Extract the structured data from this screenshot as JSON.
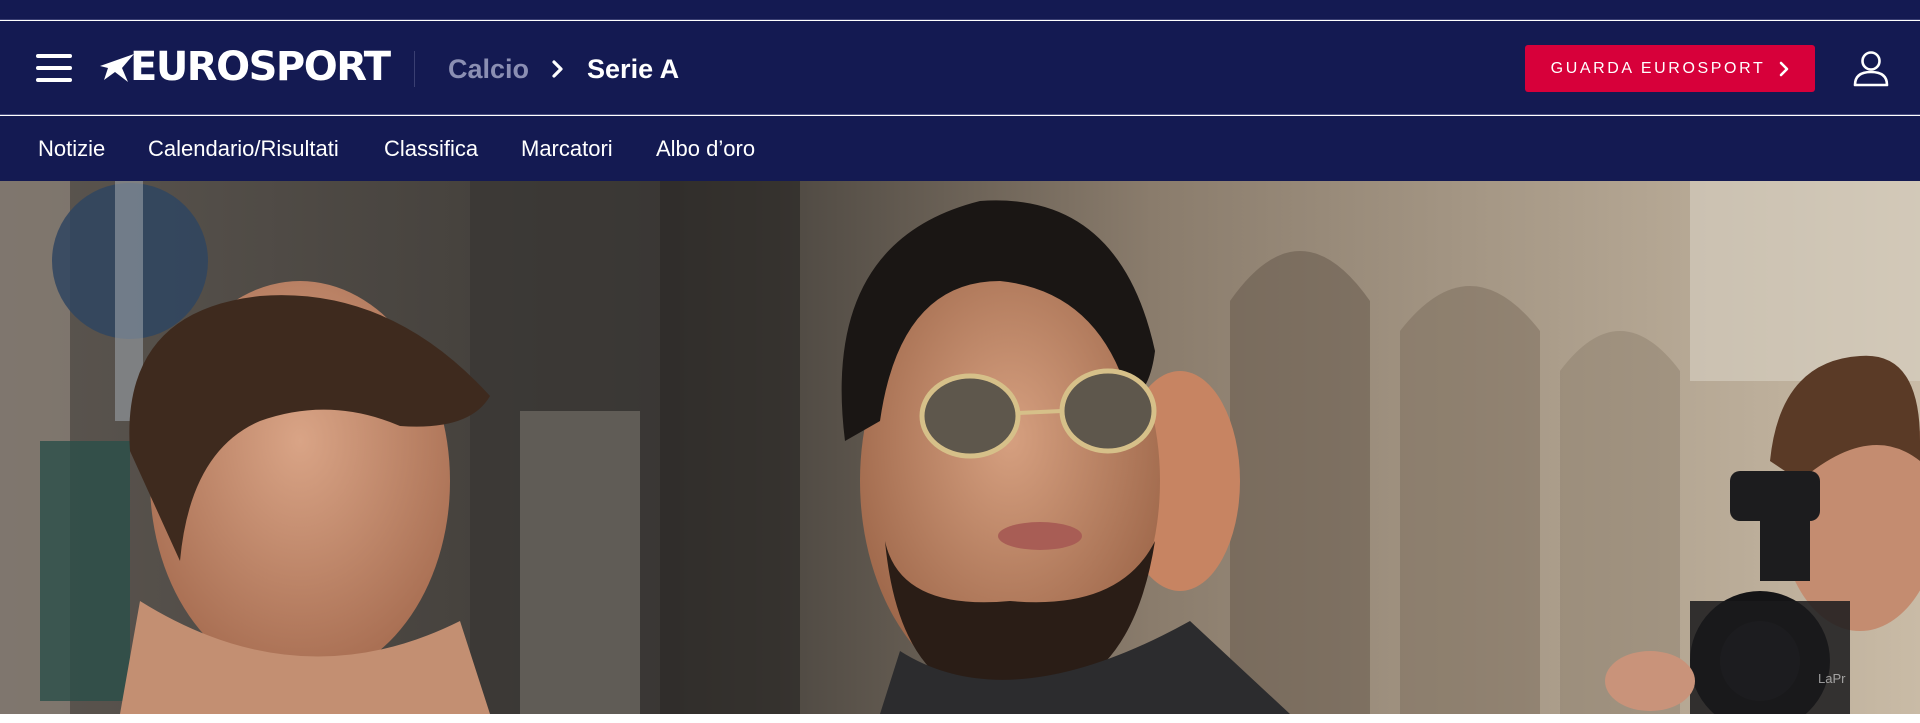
{
  "header": {
    "brand": "EUROSPORT",
    "breadcrumb": {
      "parent": "Calcio",
      "current": "Serie A"
    },
    "cta_label": "GUARDA EUROSPORT",
    "icons": {
      "menu": "hamburger-menu-icon",
      "chevron": "chevron-right-icon",
      "user": "user-account-icon"
    }
  },
  "subnav": {
    "items": [
      {
        "label": "Notizie"
      },
      {
        "label": "Calendario/Risultati"
      },
      {
        "label": "Classifica"
      },
      {
        "label": "Marcatori"
      },
      {
        "label": "Albo d’oro"
      }
    ]
  },
  "hero": {
    "credit": "LaPr"
  },
  "colors": {
    "navy": "#141a52",
    "cta_red": "#d7003a",
    "breadcrumb_parent": "#8b8fb3"
  }
}
